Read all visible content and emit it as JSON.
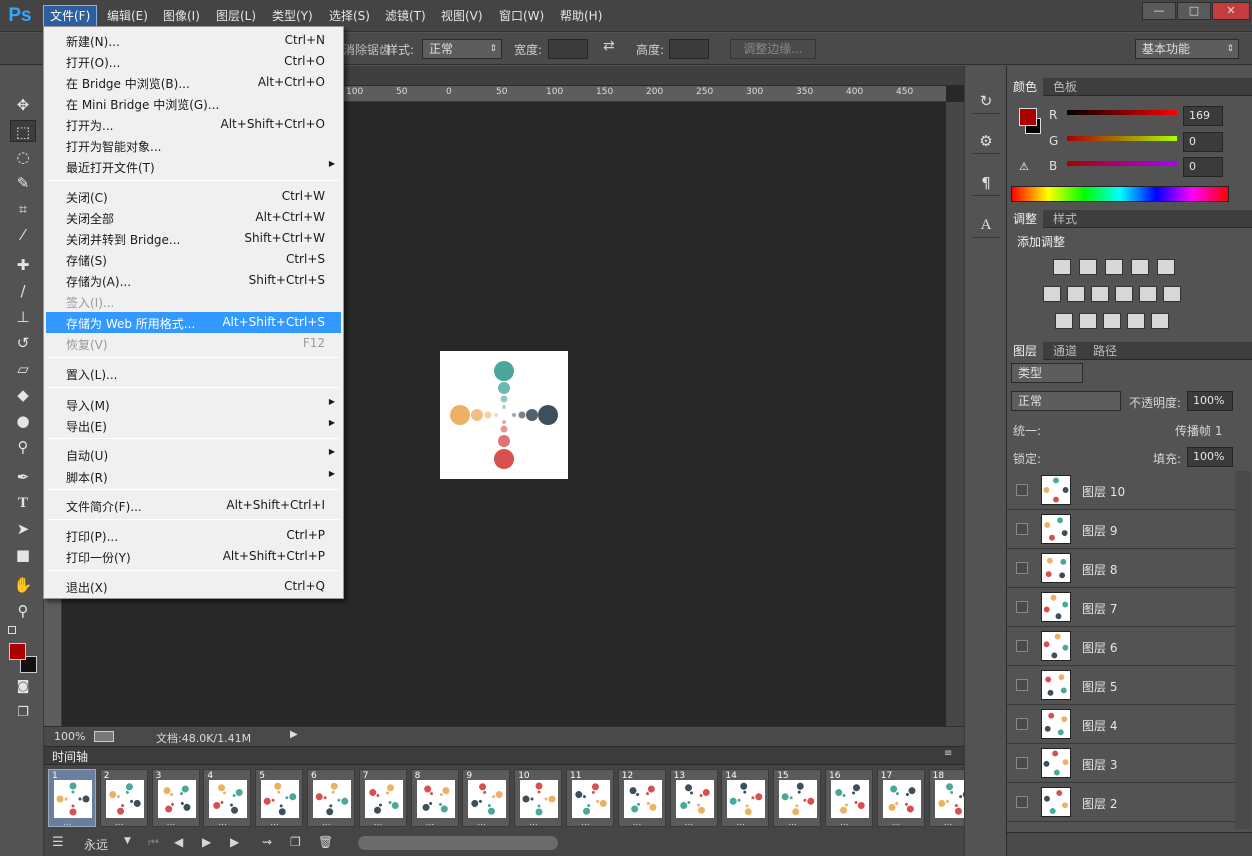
{
  "menubar": {
    "logo": "Ps",
    "items": [
      "文件(F)",
      "编辑(E)",
      "图像(I)",
      "图层(L)",
      "类型(Y)",
      "选择(S)",
      "滤镜(T)",
      "视图(V)",
      "窗口(W)",
      "帮助(H)"
    ],
    "active_index": 0,
    "window_buttons": [
      "—",
      "□",
      "✕"
    ]
  },
  "options": {
    "style_label": "样式:",
    "style_value": "正常",
    "width_label": "宽度:",
    "height_label": "高度:",
    "refine_button": "调整边缘...",
    "partial_label": "消除锯齿",
    "workspace": "基本功能"
  },
  "file_menu": [
    {
      "label": "新建(N)...",
      "shortcut": "Ctrl+N"
    },
    {
      "label": "打开(O)...",
      "shortcut": "Ctrl+O"
    },
    {
      "label": "在 Bridge 中浏览(B)...",
      "shortcut": "Alt+Ctrl+O"
    },
    {
      "label": "在 Mini Bridge 中浏览(G)...",
      "shortcut": ""
    },
    {
      "label": "打开为...",
      "shortcut": "Alt+Shift+Ctrl+O"
    },
    {
      "label": "打开为智能对象...",
      "shortcut": ""
    },
    {
      "label": "最近打开文件(T)",
      "shortcut": "",
      "submenu": true
    },
    {
      "label": "关闭(C)",
      "shortcut": "Ctrl+W"
    },
    {
      "label": "关闭全部",
      "shortcut": "Alt+Ctrl+W"
    },
    {
      "label": "关闭并转到 Bridge...",
      "shortcut": "Shift+Ctrl+W"
    },
    {
      "label": "存储(S)",
      "shortcut": "Ctrl+S"
    },
    {
      "label": "存储为(A)...",
      "shortcut": "Shift+Ctrl+S"
    },
    {
      "label": "签入(I)...",
      "shortcut": "",
      "disabled": true
    },
    {
      "label": "存储为 Web 所用格式...",
      "shortcut": "Alt+Shift+Ctrl+S",
      "highlighted": true
    },
    {
      "label": "恢复(V)",
      "shortcut": "F12",
      "disabled": true
    },
    {
      "label": "置入(L)...",
      "shortcut": ""
    },
    {
      "label": "导入(M)",
      "shortcut": "",
      "submenu": true
    },
    {
      "label": "导出(E)",
      "shortcut": "",
      "submenu": true
    },
    {
      "label": "自动(U)",
      "shortcut": "",
      "submenu": true
    },
    {
      "label": "脚本(R)",
      "shortcut": "",
      "submenu": true
    },
    {
      "label": "文件简介(F)...",
      "shortcut": "Alt+Shift+Ctrl+I"
    },
    {
      "label": "打印(P)...",
      "shortcut": "Ctrl+P"
    },
    {
      "label": "打印一份(Y)",
      "shortcut": "Alt+Shift+Ctrl+P"
    },
    {
      "label": "退出(X)",
      "shortcut": "Ctrl+Q"
    }
  ],
  "ruler_ticks": [
    "100",
    "50",
    "0",
    "50",
    "100",
    "150",
    "200",
    "250",
    "300",
    "350",
    "400",
    "450"
  ],
  "status": {
    "zoom": "100%",
    "doc_info": "文档:48.0K/1.41M"
  },
  "timeline": {
    "title": "时间轴",
    "frames": [
      "1",
      "2",
      "3",
      "4",
      "5",
      "6",
      "7",
      "8",
      "9",
      "10",
      "11",
      "12",
      "13",
      "14",
      "15",
      "16",
      "17",
      "18"
    ],
    "frame_delay": "...",
    "loop": "永远"
  },
  "color_panel": {
    "tabs": [
      "颜色",
      "色板"
    ],
    "r_label": "R",
    "g_label": "G",
    "b_label": "B",
    "r": "169",
    "g": "0",
    "b": "0",
    "fg_color": "#a90000"
  },
  "adjust_panel": {
    "tabs": [
      "调整",
      "样式"
    ],
    "title": "添加调整"
  },
  "layers_panel": {
    "tabs": [
      "图层",
      "通道",
      "路径"
    ],
    "filter": "类型",
    "blend": "正常",
    "opacity_label": "不透明度:",
    "opacity": "100%",
    "unify_label": "统一:",
    "propagate": "传播帧",
    "propagate_num": "1",
    "lock_label": "锁定:",
    "fill_label": "填充:",
    "fill": "100%",
    "layers": [
      "图层 10",
      "图层 9",
      "图层 8",
      "图层 7",
      "图层 6",
      "图层 5",
      "图层 4",
      "图层 3",
      "图层 2"
    ]
  },
  "colors": {
    "accent": "#3399ff",
    "teal": "#4aa79a",
    "orange": "#eeb062",
    "navy": "#3e4f5b",
    "red": "#d94f4f"
  }
}
